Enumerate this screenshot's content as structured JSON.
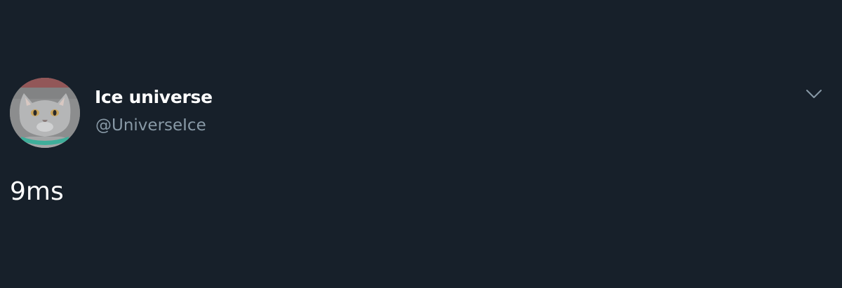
{
  "author": {
    "display_name": "Ice universe",
    "handle": "@UniverseIce",
    "avatar_icon": "cat-avatar"
  },
  "tweet": {
    "text": "9ms"
  },
  "menu": {
    "icon": "chevron-down-icon"
  },
  "colors": {
    "background": "#17202a",
    "name": "#ffffff",
    "handle": "#8899a6",
    "caret": "#8899a6"
  }
}
